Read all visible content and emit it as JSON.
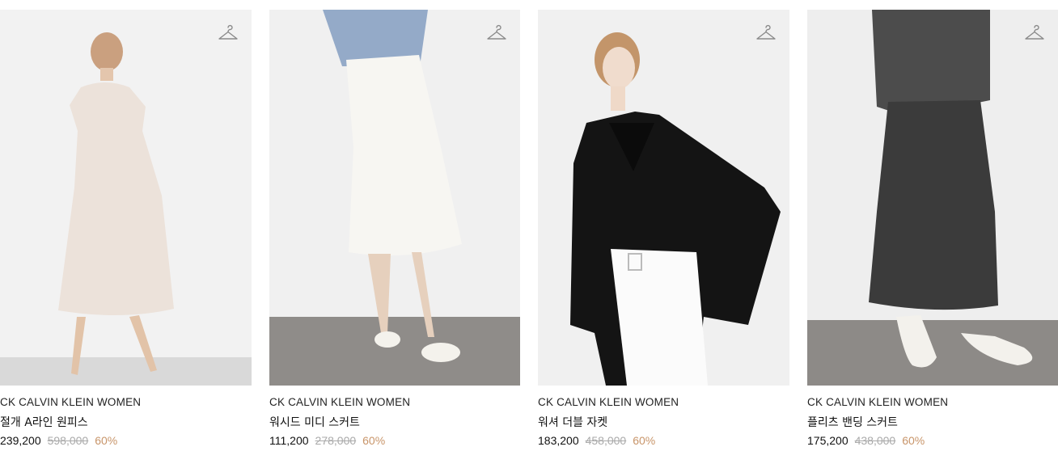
{
  "products": [
    {
      "brand": "CK CALVIN KLEIN WOMEN",
      "name": "절개 A라인 원피스",
      "price": "239,200",
      "original_price": "598,000",
      "discount": "60%",
      "wishlist_icon": "hanger-icon"
    },
    {
      "brand": "CK CALVIN KLEIN WOMEN",
      "name": "워시드 미디 스커트",
      "price": "111,200",
      "original_price": "278,000",
      "discount": "60%",
      "wishlist_icon": "hanger-icon"
    },
    {
      "brand": "CK CALVIN KLEIN WOMEN",
      "name": "워셔 더블 자켓",
      "price": "183,200",
      "original_price": "458,000",
      "discount": "60%",
      "wishlist_icon": "hanger-icon"
    },
    {
      "brand": "CK CALVIN KLEIN WOMEN",
      "name": "플리츠 밴딩 스커트",
      "price": "175,200",
      "original_price": "438,000",
      "discount": "60%",
      "wishlist_icon": "hanger-icon"
    }
  ],
  "colors": {
    "price": "#111111",
    "original_price": "#aaaaaa",
    "discount": "#c8956a",
    "icon": "#8a8a8a"
  }
}
